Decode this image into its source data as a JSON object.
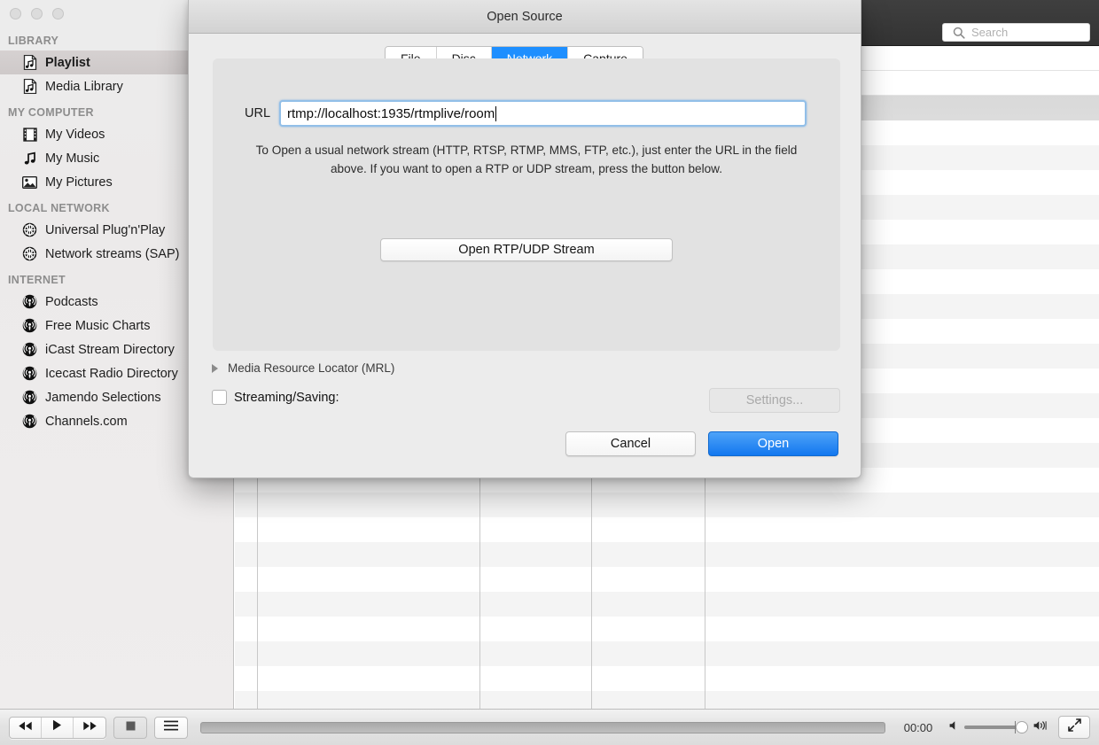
{
  "window": {
    "traffic_lights": [
      "close",
      "minimize",
      "zoom"
    ],
    "search": {
      "placeholder": "Search",
      "value": "",
      "icon": "search-icon"
    }
  },
  "sidebar": {
    "sections": [
      {
        "header": "LIBRARY",
        "items": [
          {
            "label": "Playlist",
            "icon": "playlist-file-icon",
            "selected": true
          },
          {
            "label": "Media Library",
            "icon": "playlist-file-icon",
            "selected": false
          }
        ]
      },
      {
        "header": "MY COMPUTER",
        "items": [
          {
            "label": "My Videos",
            "icon": "film-strip-icon",
            "selected": false
          },
          {
            "label": "My Music",
            "icon": "music-note-icon",
            "selected": false
          },
          {
            "label": "My Pictures",
            "icon": "picture-icon",
            "selected": false
          }
        ]
      },
      {
        "header": "LOCAL NETWORK",
        "items": [
          {
            "label": "Universal Plug'n'Play",
            "icon": "globe-icon",
            "selected": false
          },
          {
            "label": "Network streams (SAP)",
            "icon": "globe-icon",
            "selected": false
          }
        ]
      },
      {
        "header": "INTERNET",
        "items": [
          {
            "label": "Podcasts",
            "icon": "podcast-icon",
            "selected": false
          },
          {
            "label": "Free Music Charts",
            "icon": "podcast-icon",
            "selected": false
          },
          {
            "label": "iCast Stream Directory",
            "icon": "podcast-icon",
            "selected": false
          },
          {
            "label": "Icecast Radio Directory",
            "icon": "podcast-icon",
            "selected": false
          },
          {
            "label": "Jamendo Selections",
            "icon": "podcast-icon",
            "selected": false
          },
          {
            "label": "Channels.com",
            "icon": "podcast-icon",
            "selected": false
          }
        ]
      }
    ]
  },
  "playlist_table": {
    "rows": 26,
    "column_divider_x": [
      25,
      276,
      402,
      530
    ],
    "empty": true
  },
  "player_bar": {
    "previous_label": "previous",
    "play_label": "play",
    "next_label": "next",
    "stop_label": "stop",
    "playlist_label": "playlist",
    "timecode": "00:00",
    "progress_percent": 0,
    "volume_percent": 80,
    "fullscreen_label": "fullscreen"
  },
  "dialog": {
    "title": "Open Source",
    "tabs": [
      {
        "label": "File",
        "active": false
      },
      {
        "label": "Disc",
        "active": false
      },
      {
        "label": "Network",
        "active": true
      },
      {
        "label": "Capture",
        "active": false
      }
    ],
    "url_label": "URL",
    "url_value": "rtmp://localhost:1935/rtmplive/room",
    "url_placeholder": "",
    "hint": "To Open a usual network stream (HTTP, RTSP, RTMP, MMS, FTP, etc.), just enter the URL in the field above. If you want to open a RTP or UDP stream, press the button below.",
    "rtp_button": "Open RTP/UDP Stream",
    "mrl_label": "Media Resource Locator (MRL)",
    "mrl_expanded": false,
    "streaming_label": "Streaming/Saving:",
    "streaming_checked": false,
    "settings_button": "Settings...",
    "settings_disabled": true,
    "cancel_button": "Cancel",
    "open_button": "Open"
  },
  "colors": {
    "accent": "#1e8fff",
    "primary_button": "#1277ef",
    "toolbar_dark": "#333333",
    "focus_ring": "#92bfe8"
  }
}
